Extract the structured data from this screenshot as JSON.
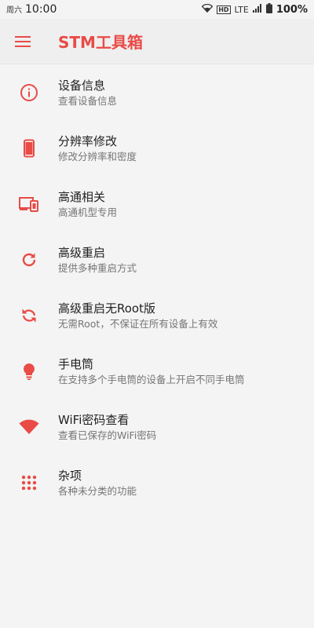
{
  "status_bar": {
    "day": "周六",
    "time": "10:00",
    "hd": "HD",
    "network": "LTE",
    "battery": "100%"
  },
  "app_bar": {
    "title": "STM工具箱"
  },
  "colors": {
    "accent": "#e94b47"
  },
  "items": [
    {
      "title": "设备信息",
      "subtitle": "查看设备信息",
      "icon": "info-icon"
    },
    {
      "title": "分辨率修改",
      "subtitle": "修改分辨率和密度",
      "icon": "phone-icon"
    },
    {
      "title": "高通相关",
      "subtitle": "高通机型专用",
      "icon": "devices-icon"
    },
    {
      "title": "高级重启",
      "subtitle": "提供多种重启方式",
      "icon": "refresh-icon"
    },
    {
      "title": "高级重启无Root版",
      "subtitle": "无需Root，不保证在所有设备上有效",
      "icon": "rotate-icon"
    },
    {
      "title": "手电筒",
      "subtitle": "在支持多个手电筒的设备上开启不同手电筒",
      "icon": "bulb-icon"
    },
    {
      "title": "WiFi密码查看",
      "subtitle": "查看已保存的WiFi密码",
      "icon": "wifi-icon"
    },
    {
      "title": "杂项",
      "subtitle": "各种未分类的功能",
      "icon": "apps-icon"
    }
  ]
}
